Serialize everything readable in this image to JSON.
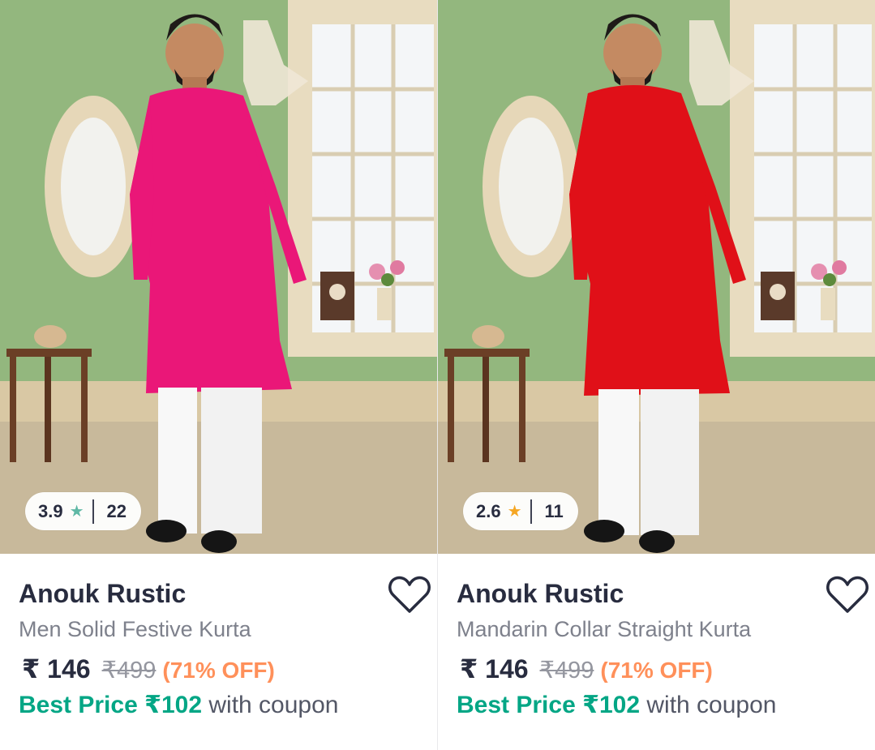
{
  "products": [
    {
      "rating": "3.9",
      "rating_star_color": "#5fb8a5",
      "review_count": "22",
      "kurta_color": "#ea1778",
      "brand": "Anouk Rustic",
      "title": "Men Solid Festive Kurta",
      "currency": "₹",
      "price": "146",
      "mrp": "₹499",
      "discount": "(71% OFF)",
      "best_price_label": "Best Price ₹102",
      "coupon_text": "with coupon",
      "wishlist_icon": "heart-outline-icon"
    },
    {
      "rating": "2.6",
      "rating_star_color": "#f5a623",
      "review_count": "11",
      "kurta_color": "#e01018",
      "brand": "Anouk Rustic",
      "title": "Mandarin Collar Straight Kurta",
      "currency": "₹",
      "price": "146",
      "mrp": "₹499",
      "discount": "(71% OFF)",
      "best_price_label": "Best Price ₹102",
      "coupon_text": "with coupon",
      "wishlist_icon": "heart-outline-icon"
    }
  ]
}
